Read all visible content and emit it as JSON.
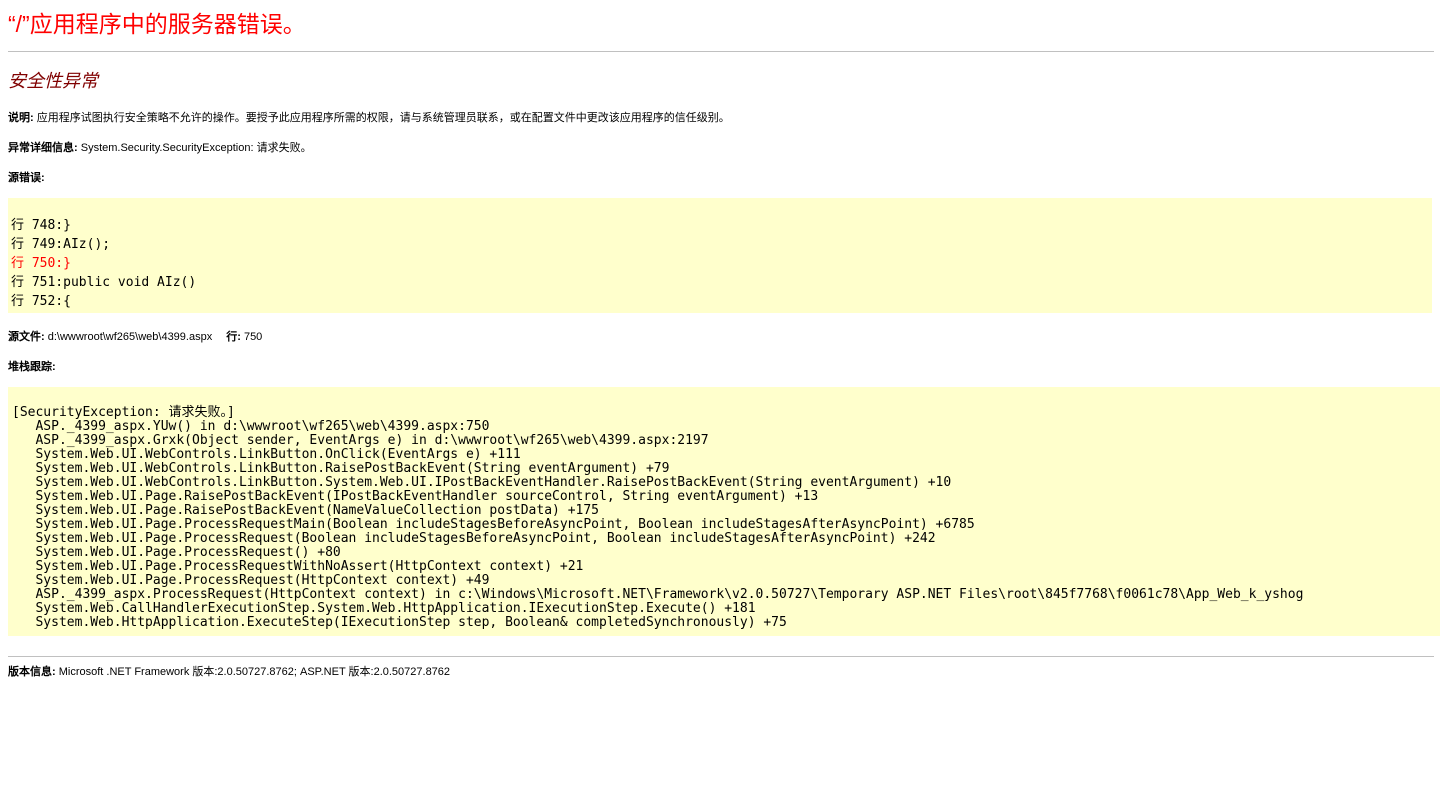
{
  "error_title": "“/”应用程序中的服务器错误。",
  "exception_heading": "安全性异常",
  "description": {
    "label": "说明:",
    "text": " 应用程序试图执行安全策略不允许的操作。要授予此应用程序所需的权限，请与系统管理员联系，或在配置文件中更改该应用程序的信任级别。"
  },
  "exception_details": {
    "label": "异常详细信息:",
    "text": " System.Security.SecurityException: 请求失败。"
  },
  "source_error": {
    "label": "源错误:",
    "lines": [
      "行 748:}",
      "行 749:AIz();",
      "行 750:}",
      "行 751:public void AIz()",
      "行 752:{"
    ],
    "highlighted_line_index": 2
  },
  "source_file": {
    "label": "源文件:",
    "path": " d:\\wwwroot\\wf265\\web\\4399.aspx",
    "line_label": "行:",
    "line_number": " 750"
  },
  "stack_trace": {
    "label": "堆栈跟踪:",
    "lines": [
      "[SecurityException: 请求失败。]",
      "   ASP._4399_aspx.YUw() in d:\\wwwroot\\wf265\\web\\4399.aspx:750",
      "   ASP._4399_aspx.Grxk(Object sender, EventArgs e) in d:\\wwwroot\\wf265\\web\\4399.aspx:2197",
      "   System.Web.UI.WebControls.LinkButton.OnClick(EventArgs e) +111",
      "   System.Web.UI.WebControls.LinkButton.RaisePostBackEvent(String eventArgument) +79",
      "   System.Web.UI.WebControls.LinkButton.System.Web.UI.IPostBackEventHandler.RaisePostBackEvent(String eventArgument) +10",
      "   System.Web.UI.Page.RaisePostBackEvent(IPostBackEventHandler sourceControl, String eventArgument) +13",
      "   System.Web.UI.Page.RaisePostBackEvent(NameValueCollection postData) +175",
      "   System.Web.UI.Page.ProcessRequestMain(Boolean includeStagesBeforeAsyncPoint, Boolean includeStagesAfterAsyncPoint) +6785",
      "   System.Web.UI.Page.ProcessRequest(Boolean includeStagesBeforeAsyncPoint, Boolean includeStagesAfterAsyncPoint) +242",
      "   System.Web.UI.Page.ProcessRequest() +80",
      "   System.Web.UI.Page.ProcessRequestWithNoAssert(HttpContext context) +21",
      "   System.Web.UI.Page.ProcessRequest(HttpContext context) +49",
      "   ASP._4399_aspx.ProcessRequest(HttpContext context) in c:\\Windows\\Microsoft.NET\\Framework\\v2.0.50727\\Temporary ASP.NET Files\\root\\845f7768\\f0061c78\\App_Web_k_yshog",
      "   System.Web.CallHandlerExecutionStep.System.Web.HttpApplication.IExecutionStep.Execute() +181",
      "   System.Web.HttpApplication.ExecuteStep(IExecutionStep step, Boolean& completedSynchronously) +75"
    ]
  },
  "version_info": {
    "label": "版本信息:",
    "text": " Microsoft .NET Framework 版本:2.0.50727.8762; ASP.NET 版本:2.0.50727.8762"
  },
  "colors": {
    "title_red": "#ff0000",
    "heading_maroon": "#800000",
    "code_background": "#ffffcc",
    "rule_gray": "#c0c0c0"
  }
}
